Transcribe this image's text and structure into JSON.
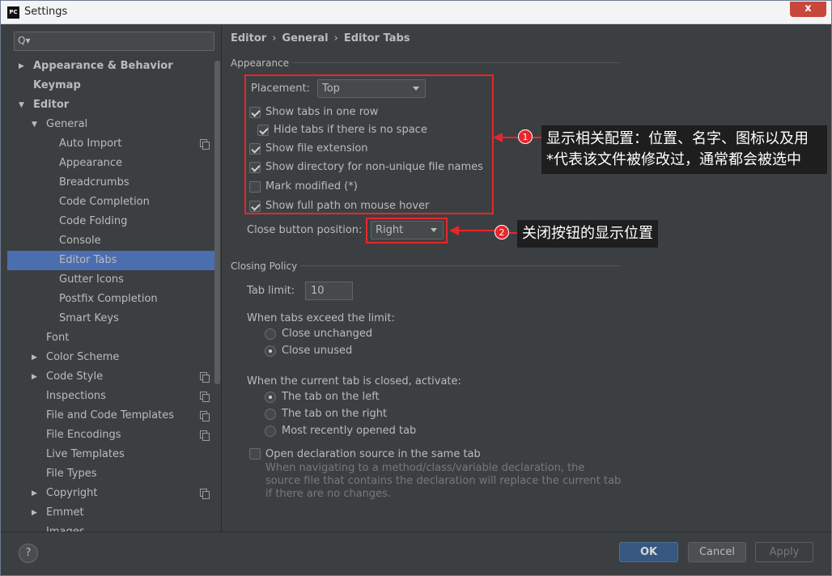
{
  "window": {
    "title": "Settings",
    "logo": "PC"
  },
  "search": {
    "placeholder": "Q▾"
  },
  "sidebar": {
    "items": [
      {
        "label": "Appearance & Behavior",
        "arrow": "▶",
        "level": 0,
        "bold": true,
        "copy": false
      },
      {
        "label": "Keymap",
        "arrow": "",
        "level": 0,
        "bold": true,
        "copy": false
      },
      {
        "label": "Editor",
        "arrow": "▼",
        "level": 0,
        "bold": true,
        "copy": false
      },
      {
        "label": "General",
        "arrow": "▼",
        "level": 1,
        "bold": false,
        "copy": false
      },
      {
        "label": "Auto Import",
        "arrow": "",
        "level": 2,
        "bold": false,
        "copy": true
      },
      {
        "label": "Appearance",
        "arrow": "",
        "level": 2,
        "bold": false,
        "copy": false
      },
      {
        "label": "Breadcrumbs",
        "arrow": "",
        "level": 2,
        "bold": false,
        "copy": false
      },
      {
        "label": "Code Completion",
        "arrow": "",
        "level": 2,
        "bold": false,
        "copy": false
      },
      {
        "label": "Code Folding",
        "arrow": "",
        "level": 2,
        "bold": false,
        "copy": false
      },
      {
        "label": "Console",
        "arrow": "",
        "level": 2,
        "bold": false,
        "copy": false
      },
      {
        "label": "Editor Tabs",
        "arrow": "",
        "level": 2,
        "bold": false,
        "copy": false,
        "selected": true
      },
      {
        "label": "Gutter Icons",
        "arrow": "",
        "level": 2,
        "bold": false,
        "copy": false
      },
      {
        "label": "Postfix Completion",
        "arrow": "",
        "level": 2,
        "bold": false,
        "copy": false
      },
      {
        "label": "Smart Keys",
        "arrow": "",
        "level": 2,
        "bold": false,
        "copy": false
      },
      {
        "label": "Font",
        "arrow": "",
        "level": 1,
        "bold": false,
        "copy": false
      },
      {
        "label": "Color Scheme",
        "arrow": "▶",
        "level": 1,
        "bold": false,
        "copy": false
      },
      {
        "label": "Code Style",
        "arrow": "▶",
        "level": 1,
        "bold": false,
        "copy": true
      },
      {
        "label": "Inspections",
        "arrow": "",
        "level": 1,
        "bold": false,
        "copy": true
      },
      {
        "label": "File and Code Templates",
        "arrow": "",
        "level": 1,
        "bold": false,
        "copy": true
      },
      {
        "label": "File Encodings",
        "arrow": "",
        "level": 1,
        "bold": false,
        "copy": true
      },
      {
        "label": "Live Templates",
        "arrow": "",
        "level": 1,
        "bold": false,
        "copy": false
      },
      {
        "label": "File Types",
        "arrow": "",
        "level": 1,
        "bold": false,
        "copy": false
      },
      {
        "label": "Copyright",
        "arrow": "▶",
        "level": 1,
        "bold": false,
        "copy": true
      },
      {
        "label": "Emmet",
        "arrow": "▶",
        "level": 1,
        "bold": false,
        "copy": false
      },
      {
        "label": "Images",
        "arrow": "",
        "level": 1,
        "bold": false,
        "copy": false
      }
    ]
  },
  "breadcrumb": {
    "items": [
      "Editor",
      "General",
      "Editor Tabs"
    ],
    "sep": "›"
  },
  "appearance": {
    "section_title": "Appearance",
    "placement_label": "Placement:",
    "placement_value": "Top",
    "show_tabs_one_row": {
      "label": "Show tabs in one row",
      "checked": true
    },
    "hide_tabs": {
      "label": "Hide tabs if there is no space",
      "checked": true
    },
    "show_file_ext": {
      "label": "Show file extension",
      "checked": true
    },
    "show_dir": {
      "label": "Show directory for non-unique file names",
      "checked": true
    },
    "mark_modified": {
      "label": "Mark modified (*)",
      "checked": false
    },
    "show_full_path": {
      "label": "Show full path on mouse hover",
      "checked": true
    },
    "close_button_label": "Close button position:",
    "close_button_value": "Right"
  },
  "closing": {
    "section_title": "Closing Policy",
    "tab_limit_label": "Tab limit:",
    "tab_limit_value": "10",
    "exceed_label": "When tabs exceed the limit:",
    "close_unchanged": {
      "label": "Close unchanged",
      "checked": false
    },
    "close_unused": {
      "label": "Close unused",
      "checked": true
    },
    "activate_label": "When the current tab is closed, activate:",
    "tab_left": {
      "label": "The tab on the left",
      "checked": true
    },
    "tab_right": {
      "label": "The tab on the right",
      "checked": false
    },
    "most_recent": {
      "label": "Most recently opened tab",
      "checked": false
    },
    "open_decl": {
      "label": "Open declaration source in the same tab",
      "checked": false
    },
    "open_decl_hint": "When navigating to a method/class/variable declaration, the source file that contains the declaration will replace the current tab if there are no changes."
  },
  "annotations": {
    "badge1": "1",
    "callout1_line1": "显示相关配置：位置、名字、图标以及用",
    "callout1_line2": "*代表该文件被修改过，通常都会被选中",
    "badge2": "2",
    "callout2": "关闭按钮的显示位置",
    "color": "#e8262b"
  },
  "buttons": {
    "help": "?",
    "ok": "OK",
    "cancel": "Cancel",
    "apply": "Apply"
  },
  "close_icon": "x"
}
